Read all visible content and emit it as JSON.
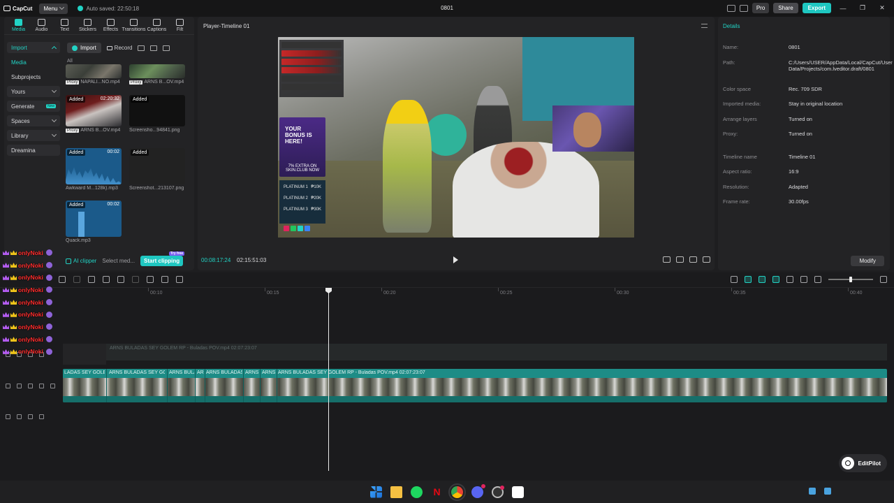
{
  "app": {
    "logo_text": "CapCut",
    "menu_label": "Menu",
    "autosave_text": "Auto saved: 22:50:18",
    "project_title": "0801",
    "pro_label": "Pro",
    "share_label": "Share",
    "export_label": "Export",
    "accent_color": "#22d3c5"
  },
  "left_panel": {
    "tabs": [
      {
        "label": "Media",
        "icon": "media-icon",
        "active": true
      },
      {
        "label": "Audio",
        "icon": "audio-icon"
      },
      {
        "label": "Text",
        "icon": "text-icon"
      },
      {
        "label": "Stickers",
        "icon": "stickers-icon"
      },
      {
        "label": "Effects",
        "icon": "effects-icon"
      },
      {
        "label": "Transitions",
        "icon": "transitions-icon"
      },
      {
        "label": "Captions",
        "icon": "captions-icon"
      },
      {
        "label": "Filt",
        "icon": "filters-icon"
      }
    ],
    "nav": {
      "import": "Import",
      "media": "Media",
      "subprojects": "Subprojects",
      "yours": "Yours",
      "generate": "Generate",
      "generate_badge": "New",
      "spaces": "Spaces",
      "library": "Library",
      "dreamina": "Dreamina"
    },
    "toolbar": {
      "import": "Import",
      "record": "Record"
    },
    "filter_label": "All",
    "media_items": [
      {
        "name": "NAPALI...NO.mp4",
        "proxy": "Proxy",
        "added": "",
        "duration": ""
      },
      {
        "name": "ARNS B...OV.mp4",
        "proxy": "Proxy",
        "added": "",
        "duration": ""
      },
      {
        "name": "ARNS B...OV.mp4",
        "proxy": "Proxy",
        "added": "Added",
        "duration": "02:20:32"
      },
      {
        "name": "Screensho...94841.png",
        "proxy": "",
        "added": "Added",
        "duration": ""
      },
      {
        "name": "Awkward M...128k).mp3",
        "proxy": "",
        "added": "Added",
        "duration": "00:02"
      },
      {
        "name": "Screenshot...213107.png",
        "proxy": "",
        "added": "Added",
        "duration": ""
      },
      {
        "name": "Quack.mp3",
        "proxy": "",
        "added": "Added",
        "duration": "00:02"
      }
    ],
    "footer": {
      "ai_clipper": "AI clipper",
      "select_media": "Select med...",
      "start_clipping": "Start clipping",
      "try_free": "Try free"
    }
  },
  "player": {
    "title": "Player-Timeline 01",
    "current_time": "00:08:17:24",
    "total_time": "02:15:51:03",
    "overlay_promo": "YOUR BONUS IS HERE!",
    "overlay_extra": "7% EXTRA ON SKIN.CLUB NOW",
    "overlay_rows": [
      {
        "label": "PLATINUM 1",
        "value": "₱10K"
      },
      {
        "label": "PLATINUM 2",
        "value": "₱20K"
      },
      {
        "label": "PLATINUM 3",
        "value": "₱30K"
      }
    ]
  },
  "details": {
    "title": "Details",
    "rows": [
      {
        "key": "Name:",
        "value": "0801"
      },
      {
        "key": "Path:",
        "value": "C:/Users/USER/AppData/Local/CapCut/User Data/Projects/com.lveditor.draft/0801"
      },
      {
        "key": "Color space",
        "value": "Rec. 709 SDR"
      },
      {
        "key": "Imported media:",
        "value": "Stay in original location"
      },
      {
        "key": "Arrange layers",
        "value": "Turned on"
      },
      {
        "key": "Proxy:",
        "value": "Turned on"
      },
      {
        "key": "Timeline name",
        "value": "Timeline 01"
      },
      {
        "key": "Aspect ratio:",
        "value": "16:9"
      },
      {
        "key": "Resolution:",
        "value": "Adapted"
      },
      {
        "key": "Frame rate:",
        "value": "30.00fps"
      }
    ],
    "modify_label": "Modify"
  },
  "timeline": {
    "ruler_labels": [
      "00:10",
      "00:15",
      "00:20",
      "00:25",
      "00:30",
      "00:35",
      "00:40"
    ],
    "ghost_clip_label": "ARNS BULADAS SEY GOLEM RP - Buladas POV.mp4  02:07:23:07",
    "clip_segments": [
      "LADAS SEY GOLEM",
      "ARNS BULADAS SEY GOLEM",
      "ARNS BULA",
      "AR",
      "ARNS BULADAS",
      "ARNS",
      "ARNS",
      "ARNS BULADAS SEY GOLEM RP - Buladas  POV.mp4   02:07:23:07"
    ],
    "zoom_level": 0.5
  },
  "editpilot_label": "EditPilot",
  "chat": {
    "username": "onlyNoki",
    "lines": 9
  }
}
